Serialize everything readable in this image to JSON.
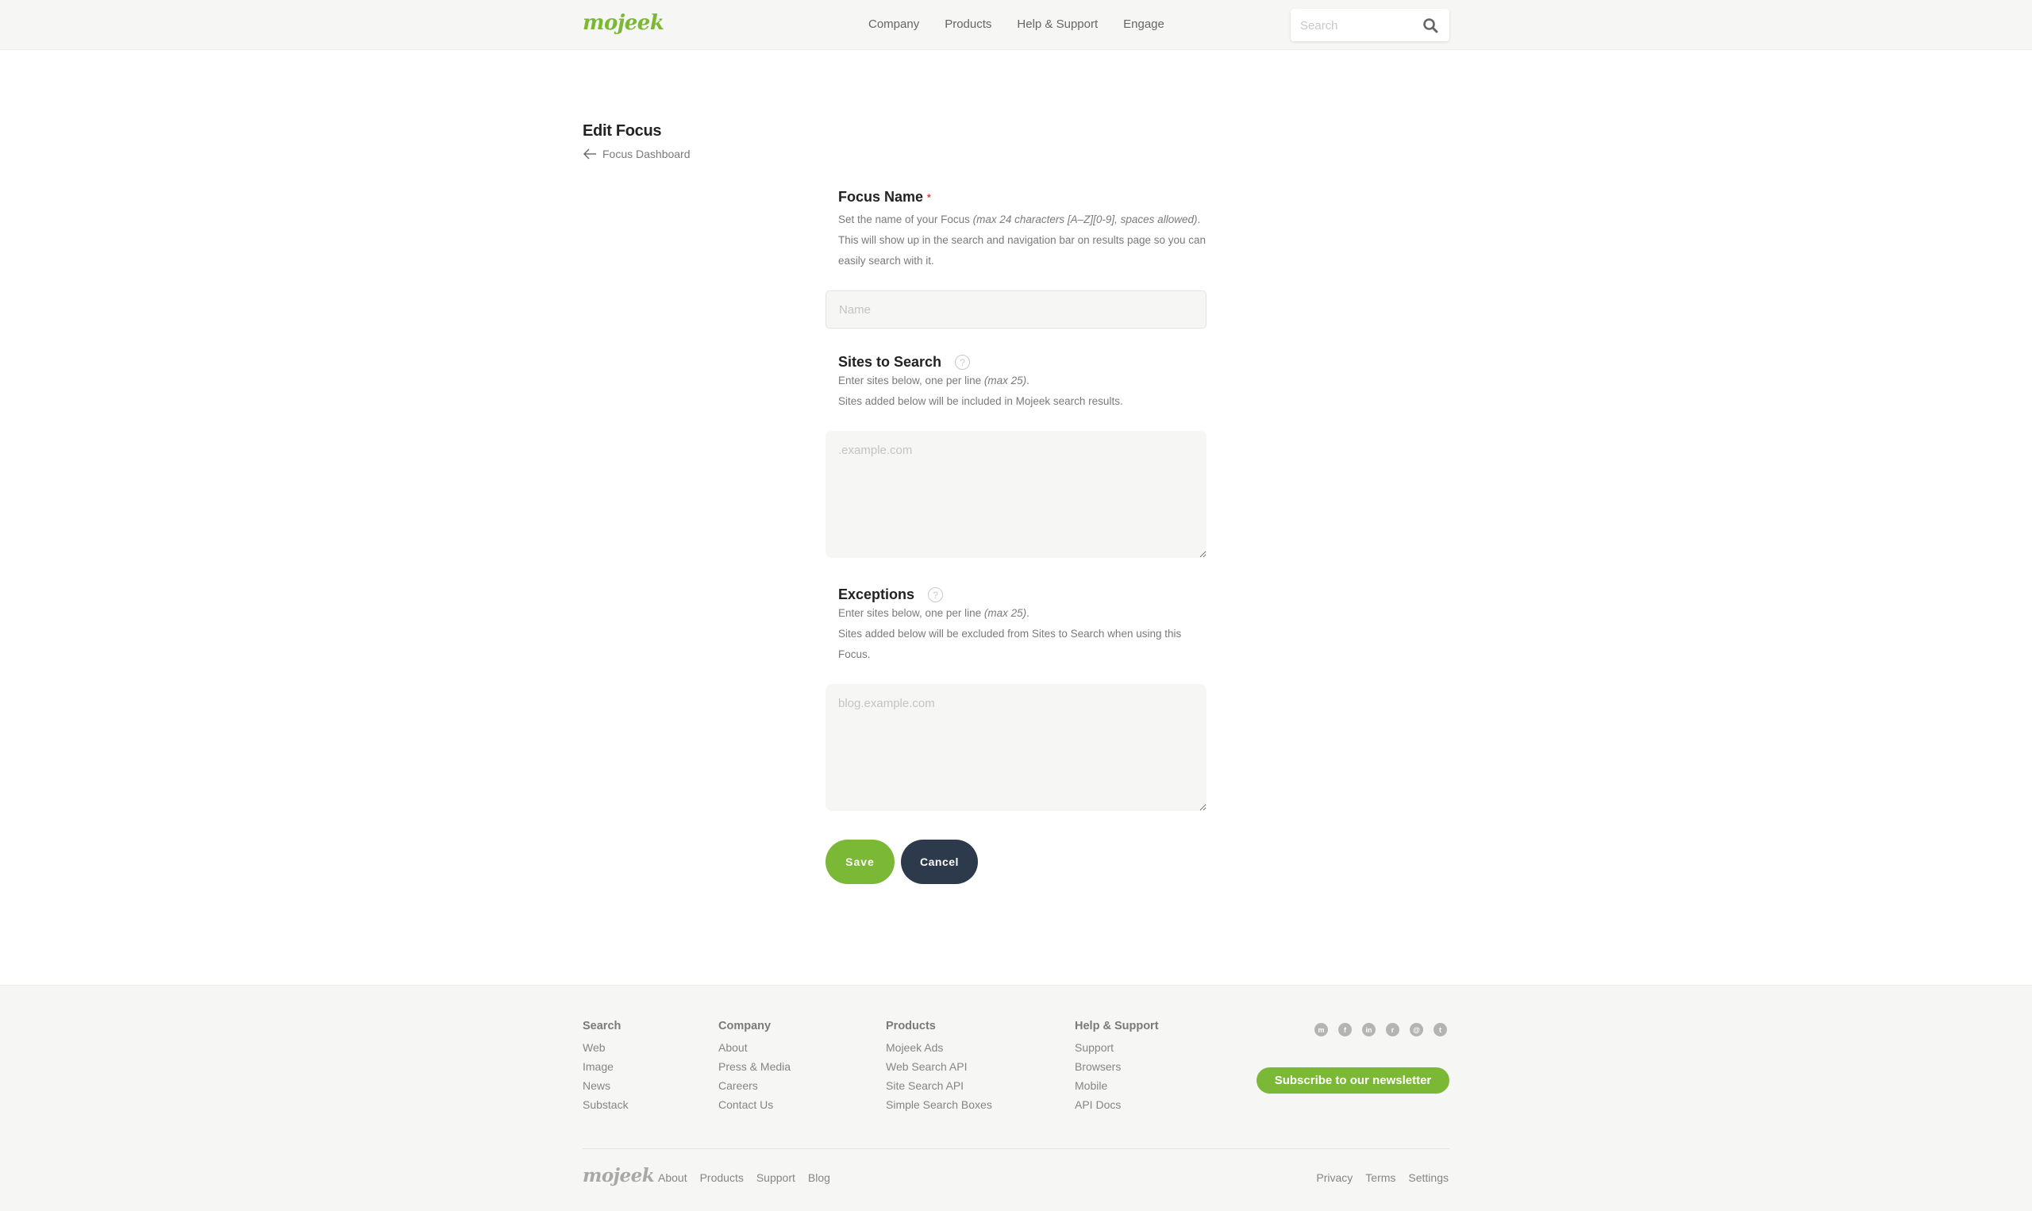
{
  "header": {
    "logo": "mojeek",
    "nav": [
      "Company",
      "Products",
      "Help & Support",
      "Engage"
    ],
    "search_placeholder": "Search",
    "search_icon": "search-icon"
  },
  "page": {
    "title": "Edit Focus",
    "back_label": "Focus Dashboard",
    "back_icon": "arrow-left-icon"
  },
  "form": {
    "focus_name": {
      "label": "Focus Name",
      "required_mark": "*",
      "desc_line1_plain": "Set the name of your Focus ",
      "desc_line1_italic": "(max 24 characters [A–Z][0-9], spaces allowed)",
      "desc_line1_end": ".",
      "desc_line2": "This will show up in the search and navigation bar on results page so you can easily search with it.",
      "value": "",
      "placeholder": "Name"
    },
    "sites_to_search": {
      "label": "Sites to Search",
      "help_icon": "question-circle-icon",
      "desc_line1_plain": "Enter sites below, one per line ",
      "desc_line1_italic": "(max 25)",
      "desc_line1_end": ".",
      "desc_line2": "Sites added below will be included in Mojeek search results.",
      "value": "",
      "placeholder": ".example.com"
    },
    "exceptions": {
      "label": "Exceptions",
      "help_icon": "question-circle-icon",
      "desc_line1_plain": "Enter sites below, one per line ",
      "desc_line1_italic": "(max 25)",
      "desc_line1_end": ".",
      "desc_line2": "Sites added below will be excluded from Sites to Search when using this Focus.",
      "value": "",
      "placeholder": "blog.example.com"
    },
    "save_label": "Save",
    "cancel_label": "Cancel"
  },
  "footer": {
    "columns": [
      {
        "title": "Search",
        "links": [
          "Web",
          "Image",
          "News",
          "Substack"
        ]
      },
      {
        "title": "Company",
        "links": [
          "About",
          "Press & Media",
          "Careers",
          "Contact Us"
        ]
      },
      {
        "title": "Products",
        "links": [
          "Mojeek Ads",
          "Web Search API",
          "Site Search API",
          "Simple Search Boxes"
        ]
      },
      {
        "title": "Help & Support",
        "links": [
          "Support",
          "Browsers",
          "Mobile",
          "API Docs"
        ]
      }
    ],
    "socials": [
      {
        "name": "mastodon-m-icon",
        "glyph": "m"
      },
      {
        "name": "facebook-icon",
        "glyph": "f"
      },
      {
        "name": "linkedin-icon",
        "glyph": "in"
      },
      {
        "name": "reddit-icon",
        "glyph": "r"
      },
      {
        "name": "mastodon-icon",
        "glyph": "@"
      },
      {
        "name": "twitter-icon",
        "glyph": "t"
      }
    ],
    "newsletter_label": "Subscribe to our newsletter",
    "logo": "mojeek",
    "bottom_left": [
      "About",
      "Products",
      "Support",
      "Blog"
    ],
    "bottom_right": [
      "Privacy",
      "Terms",
      "Settings"
    ]
  },
  "colors": {
    "brand_green": "#7ab835",
    "cancel_navy": "#2c3a4c",
    "required_red": "#e33333"
  }
}
